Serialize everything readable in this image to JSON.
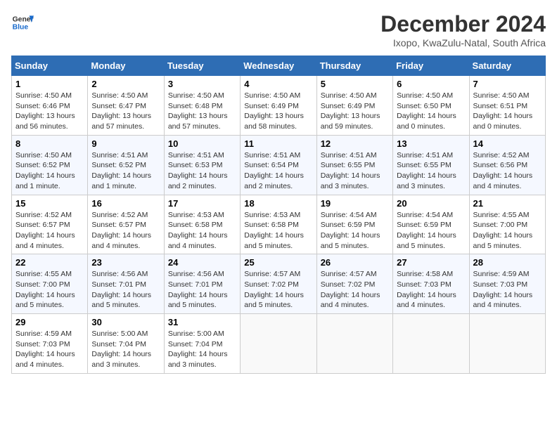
{
  "header": {
    "logo_line1": "General",
    "logo_line2": "Blue",
    "title": "December 2024",
    "subtitle": "Ixopo, KwaZulu-Natal, South Africa"
  },
  "weekdays": [
    "Sunday",
    "Monday",
    "Tuesday",
    "Wednesday",
    "Thursday",
    "Friday",
    "Saturday"
  ],
  "weeks": [
    [
      {
        "day": "1",
        "info": "Sunrise: 4:50 AM\nSunset: 6:46 PM\nDaylight: 13 hours\nand 56 minutes."
      },
      {
        "day": "2",
        "info": "Sunrise: 4:50 AM\nSunset: 6:47 PM\nDaylight: 13 hours\nand 57 minutes."
      },
      {
        "day": "3",
        "info": "Sunrise: 4:50 AM\nSunset: 6:48 PM\nDaylight: 13 hours\nand 57 minutes."
      },
      {
        "day": "4",
        "info": "Sunrise: 4:50 AM\nSunset: 6:49 PM\nDaylight: 13 hours\nand 58 minutes."
      },
      {
        "day": "5",
        "info": "Sunrise: 4:50 AM\nSunset: 6:49 PM\nDaylight: 13 hours\nand 59 minutes."
      },
      {
        "day": "6",
        "info": "Sunrise: 4:50 AM\nSunset: 6:50 PM\nDaylight: 14 hours\nand 0 minutes."
      },
      {
        "day": "7",
        "info": "Sunrise: 4:50 AM\nSunset: 6:51 PM\nDaylight: 14 hours\nand 0 minutes."
      }
    ],
    [
      {
        "day": "8",
        "info": "Sunrise: 4:50 AM\nSunset: 6:52 PM\nDaylight: 14 hours\nand 1 minute."
      },
      {
        "day": "9",
        "info": "Sunrise: 4:51 AM\nSunset: 6:52 PM\nDaylight: 14 hours\nand 1 minute."
      },
      {
        "day": "10",
        "info": "Sunrise: 4:51 AM\nSunset: 6:53 PM\nDaylight: 14 hours\nand 2 minutes."
      },
      {
        "day": "11",
        "info": "Sunrise: 4:51 AM\nSunset: 6:54 PM\nDaylight: 14 hours\nand 2 minutes."
      },
      {
        "day": "12",
        "info": "Sunrise: 4:51 AM\nSunset: 6:55 PM\nDaylight: 14 hours\nand 3 minutes."
      },
      {
        "day": "13",
        "info": "Sunrise: 4:51 AM\nSunset: 6:55 PM\nDaylight: 14 hours\nand 3 minutes."
      },
      {
        "day": "14",
        "info": "Sunrise: 4:52 AM\nSunset: 6:56 PM\nDaylight: 14 hours\nand 4 minutes."
      }
    ],
    [
      {
        "day": "15",
        "info": "Sunrise: 4:52 AM\nSunset: 6:57 PM\nDaylight: 14 hours\nand 4 minutes."
      },
      {
        "day": "16",
        "info": "Sunrise: 4:52 AM\nSunset: 6:57 PM\nDaylight: 14 hours\nand 4 minutes."
      },
      {
        "day": "17",
        "info": "Sunrise: 4:53 AM\nSunset: 6:58 PM\nDaylight: 14 hours\nand 4 minutes."
      },
      {
        "day": "18",
        "info": "Sunrise: 4:53 AM\nSunset: 6:58 PM\nDaylight: 14 hours\nand 5 minutes."
      },
      {
        "day": "19",
        "info": "Sunrise: 4:54 AM\nSunset: 6:59 PM\nDaylight: 14 hours\nand 5 minutes."
      },
      {
        "day": "20",
        "info": "Sunrise: 4:54 AM\nSunset: 6:59 PM\nDaylight: 14 hours\nand 5 minutes."
      },
      {
        "day": "21",
        "info": "Sunrise: 4:55 AM\nSunset: 7:00 PM\nDaylight: 14 hours\nand 5 minutes."
      }
    ],
    [
      {
        "day": "22",
        "info": "Sunrise: 4:55 AM\nSunset: 7:00 PM\nDaylight: 14 hours\nand 5 minutes."
      },
      {
        "day": "23",
        "info": "Sunrise: 4:56 AM\nSunset: 7:01 PM\nDaylight: 14 hours\nand 5 minutes."
      },
      {
        "day": "24",
        "info": "Sunrise: 4:56 AM\nSunset: 7:01 PM\nDaylight: 14 hours\nand 5 minutes."
      },
      {
        "day": "25",
        "info": "Sunrise: 4:57 AM\nSunset: 7:02 PM\nDaylight: 14 hours\nand 5 minutes."
      },
      {
        "day": "26",
        "info": "Sunrise: 4:57 AM\nSunset: 7:02 PM\nDaylight: 14 hours\nand 4 minutes."
      },
      {
        "day": "27",
        "info": "Sunrise: 4:58 AM\nSunset: 7:03 PM\nDaylight: 14 hours\nand 4 minutes."
      },
      {
        "day": "28",
        "info": "Sunrise: 4:59 AM\nSunset: 7:03 PM\nDaylight: 14 hours\nand 4 minutes."
      }
    ],
    [
      {
        "day": "29",
        "info": "Sunrise: 4:59 AM\nSunset: 7:03 PM\nDaylight: 14 hours\nand 4 minutes."
      },
      {
        "day": "30",
        "info": "Sunrise: 5:00 AM\nSunset: 7:04 PM\nDaylight: 14 hours\nand 3 minutes."
      },
      {
        "day": "31",
        "info": "Sunrise: 5:00 AM\nSunset: 7:04 PM\nDaylight: 14 hours\nand 3 minutes."
      },
      null,
      null,
      null,
      null
    ]
  ]
}
